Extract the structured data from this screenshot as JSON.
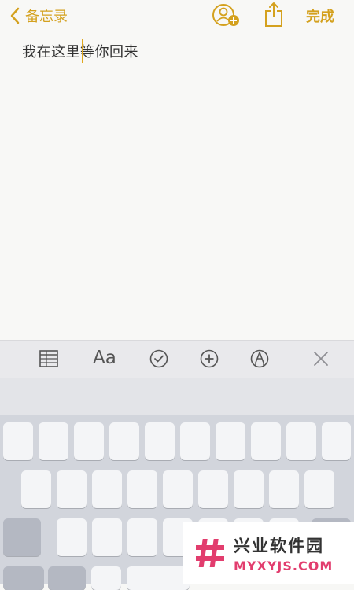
{
  "nav": {
    "back_label": "备忘录",
    "done_label": "完成"
  },
  "note": {
    "text": "我在这里等你回来"
  },
  "toolbar": {
    "items": [
      {
        "icon": "table-icon"
      },
      {
        "icon": "text-format-icon",
        "label": "Aa"
      },
      {
        "icon": "checklist-icon"
      },
      {
        "icon": "plus-circle-icon"
      },
      {
        "icon": "markup-pen-icon"
      },
      {
        "icon": "close-icon"
      }
    ]
  },
  "watermark": {
    "title": "兴业软件园",
    "subtitle": "MYXYJS.COM"
  },
  "colors": {
    "accent": "#d4a11e",
    "watermark_accent": "#e23d6e"
  }
}
